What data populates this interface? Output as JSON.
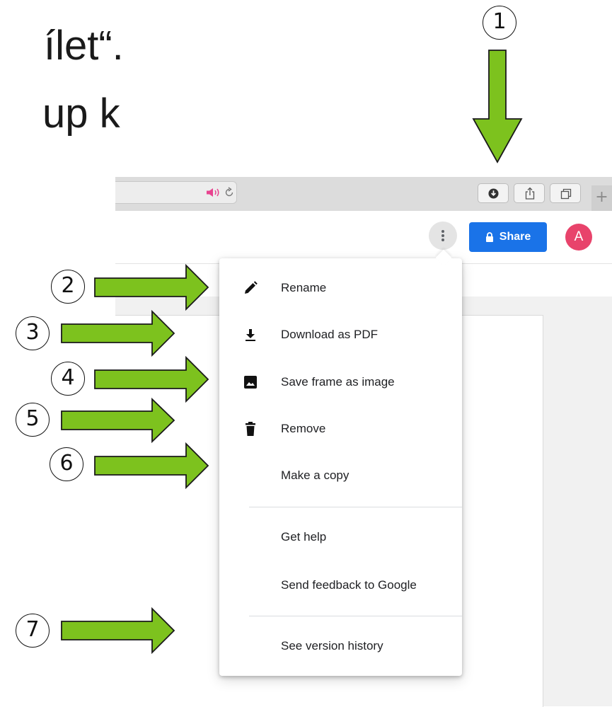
{
  "slide_text": {
    "line1": "ílet“.",
    "line2": "up k"
  },
  "browser_toolbar": {
    "plus_label": "+",
    "icons": [
      "speaker-icon",
      "reload-icon",
      "download-icon",
      "share-sheet-icon",
      "tabs-icon"
    ]
  },
  "app_header": {
    "share_label": "Share",
    "avatar_initial": "A"
  },
  "menu": {
    "items": [
      {
        "label": "Rename",
        "icon": "pencil-icon"
      },
      {
        "label": "Download as PDF",
        "icon": "download-icon"
      },
      {
        "label": "Save frame as image",
        "icon": "image-icon"
      },
      {
        "label": "Remove",
        "icon": "trash-icon"
      },
      {
        "label": "Make a copy",
        "icon": ""
      },
      {
        "label": "Get help",
        "icon": ""
      },
      {
        "label": "Send feedback to Google",
        "icon": ""
      },
      {
        "label": "See version history",
        "icon": ""
      }
    ]
  },
  "callouts": [
    "1",
    "2",
    "3",
    "4",
    "5",
    "6",
    "7"
  ],
  "colors": {
    "arrow_fill": "#7dc21e",
    "share_blue": "#1a73e8",
    "avatar_pink": "#e8436b",
    "speaker_pink": "#e8438f"
  }
}
